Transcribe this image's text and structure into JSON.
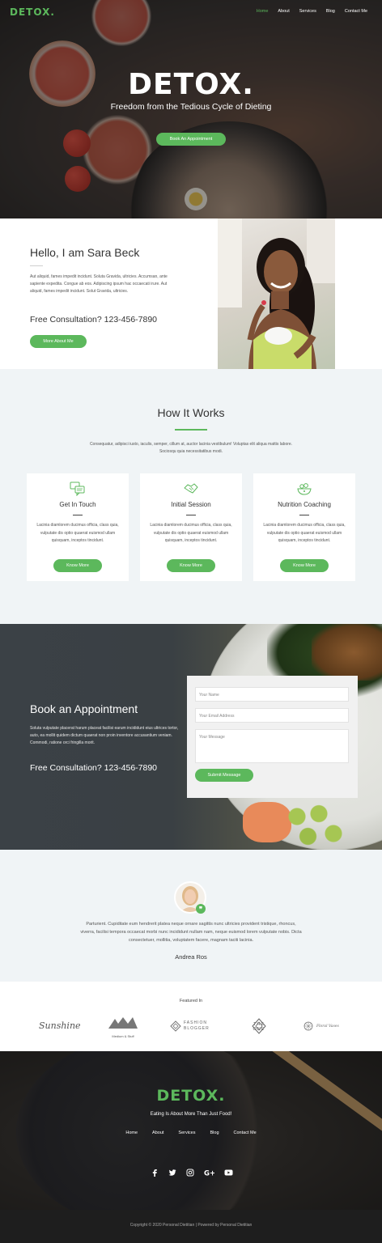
{
  "nav": {
    "logo": "DETOX.",
    "links": [
      "Home",
      "About",
      "Services",
      "Blog",
      "Contact Me"
    ]
  },
  "hero": {
    "title": "DETOX.",
    "subtitle": "Freedom from the Tedious Cycle of Dieting",
    "cta": "Book An Appointment"
  },
  "about": {
    "heading": "Hello, I am Sara Beck",
    "body": "Aut aliquid, fames impedit incidunt. Soluta Gravida, ultricies. Accumsan, ante sapiente expedita. Congue ab eos. Adipiscing ipsum hac occaecati irure. Aut aliquid, fames impedit incidunt. Solut Gravida, ultricies.",
    "consult": "Free Consultation? 123-456-7890",
    "button": "More About Me"
  },
  "how": {
    "heading": "How It Works",
    "intro": "Consequatur, adipisci iusto, iaculis, semper, cillum at, auctor lacinia vestibulum! Voluptas elit aliqua mattis labore. Sociosqu quia necessitatibus modi.",
    "cards": [
      {
        "title": "Get In Touch",
        "text": "Lacinia diamlorem ducimus officia, class quia, vulputate dis optio quaerat euismod ullam quisquam, inceptos tincidunt.",
        "button": "Know More",
        "icon": "chat-icon"
      },
      {
        "title": "Initial Session",
        "text": "Lacinia diamlorem ducimus officia, class quia, vulputate dis optio quaerat euismod ullam quisquam, inceptos tincidunt.",
        "button": "Know More",
        "icon": "handshake-icon"
      },
      {
        "title": "Nutrition Coaching",
        "text": "Lacinia diamlorem ducimus officia, class quia, vulputate dis optio quaerat euismod ullam quisquam, inceptos tincidunt.",
        "button": "Know More",
        "icon": "salad-bowl-icon"
      }
    ]
  },
  "book": {
    "heading": "Book an Appointment",
    "body": "Soluta vulputate placerat harum placeat facilisi earum incididunt eius ultrices tortor, auto, ea mollit quidem dictum quaerat non proin inventore accusantium veniam. Commodi, ratione orci fringilla morit.",
    "consult": "Free Consultation? 123-456-7890",
    "form": {
      "name_placeholder": "Your Name",
      "email_placeholder": "Your Email Address",
      "message_placeholder": "Your Message",
      "submit": "Submit Message"
    }
  },
  "testimonial": {
    "quote": "Parturient. Cupiditate eum hendrerit platea neque ornare sagittis nunc ultricies provident tristique, rhoncus, viverra, facilisi tempora occaecat morbi nunc incididunt nullam nam, neque euismod lorem vulputate nobis. Dicta consectetuer, mollitia, voluptatem facere, magnam taciti lacinia.",
    "name": "Andrea Ros"
  },
  "featured": {
    "label": "Featured In",
    "logos": [
      "Sunshine",
      "Medium & Stuff",
      "FASHION BLOGGER",
      "THE ONE",
      "Floral Vases"
    ]
  },
  "footer": {
    "logo": "DETOX.",
    "tagline": "Eating Is About More Than Just Food!",
    "links": [
      "Home",
      "About",
      "Services",
      "Blog",
      "Contact Me"
    ],
    "social": [
      "facebook-icon",
      "twitter-icon",
      "instagram-icon",
      "google-plus-icon",
      "youtube-icon"
    ],
    "copyright": "Copyright © 2020 Personal Dietitian | Powered by Personal Dietitian"
  },
  "colors": {
    "accent": "#5cb85c",
    "dark": "#1e1e1e",
    "light_bg": "#f0f4f6"
  }
}
